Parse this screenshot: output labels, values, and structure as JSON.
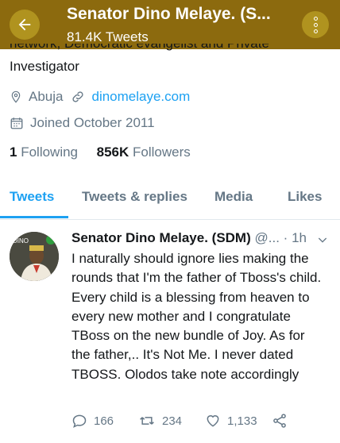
{
  "header": {
    "title": "Senator Dino Melaye. (S...",
    "tweet_count": "81.4K Tweets"
  },
  "profile": {
    "bio_cutoff": "network, Democratic evangelist and Private",
    "bio_tail": "Investigator",
    "location": "Abuja",
    "website": "dinomelaye.com",
    "joined": "Joined October 2011",
    "following_count": "1",
    "following_label": "Following",
    "followers_count": "856K",
    "followers_label": "Followers"
  },
  "tabs": [
    {
      "label": "Tweets",
      "active": true
    },
    {
      "label": "Tweets & replies",
      "active": false
    },
    {
      "label": "Media",
      "active": false
    },
    {
      "label": "Likes",
      "active": false
    }
  ],
  "tweet": {
    "author": "Senator Dino Melaye. (SDM)",
    "handle": "@...",
    "separator": "·",
    "time": "1h",
    "avatar_text": "DINO",
    "text": "I naturally should ignore lies making the rounds that I'm the father of Tboss's child. Every child is a blessing from heaven to every new mother and I congratulate TBoss on the new bundle of Joy. As for the father,.. It's Not Me. I never dated TBOSS. Olodos take note accordingly",
    "replies": "166",
    "retweets": "234",
    "likes": "1,133"
  },
  "colors": {
    "header_bg": "#8c6a0e",
    "accent": "#1da1f2",
    "muted": "#657786"
  }
}
